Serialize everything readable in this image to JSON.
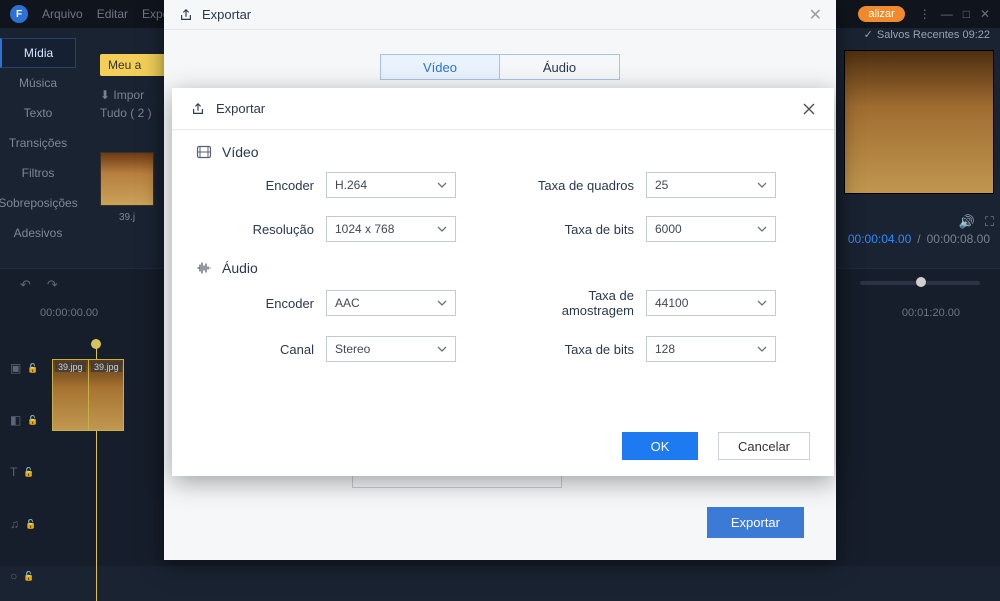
{
  "topbar": {
    "menus": [
      "Arquivo",
      "Editar",
      "Expo"
    ],
    "upgrade_label": "alizar",
    "saved_label": "Salvos Recentes 09:22"
  },
  "side_tabs": [
    "Mídia",
    "Música",
    "Texto",
    "Transições",
    "Filtros",
    "Sobreposições",
    "Adesivos"
  ],
  "project_banner": "Meu a",
  "media_panel": {
    "import": "Impor",
    "count": "Tudo ( 2 )",
    "thumb": "39.j"
  },
  "timecode": {
    "current": "00:00:04.00",
    "sep": "/",
    "total": "00:00:08.00"
  },
  "timeline": {
    "marks": [
      "00:00:00.00",
      "00:01:20.00"
    ],
    "clip_badges": [
      "39.jpg",
      "39.jpg"
    ]
  },
  "export_outer": {
    "title": "Exportar",
    "tab_video": "Vídeo",
    "tab_audio": "Áudio",
    "export_btn": "Exportar"
  },
  "dialog": {
    "title": "Exportar",
    "video_section": "Vídeo",
    "audio_section": "Áudio",
    "labels": {
      "encoder": "Encoder",
      "resolution": "Resolução",
      "framerate": "Taxa de quadros",
      "bitrate": "Taxa de bits",
      "samplerate": "Taxa de amostragem",
      "channel": "Canal"
    },
    "values": {
      "v_encoder": "H.264",
      "resolution": "1024 x 768",
      "framerate": "25",
      "v_bitrate": "6000",
      "a_encoder": "AAC",
      "channel": "Stereo",
      "samplerate": "44100",
      "a_bitrate": "128"
    },
    "ok": "OK",
    "cancel": "Cancelar"
  }
}
